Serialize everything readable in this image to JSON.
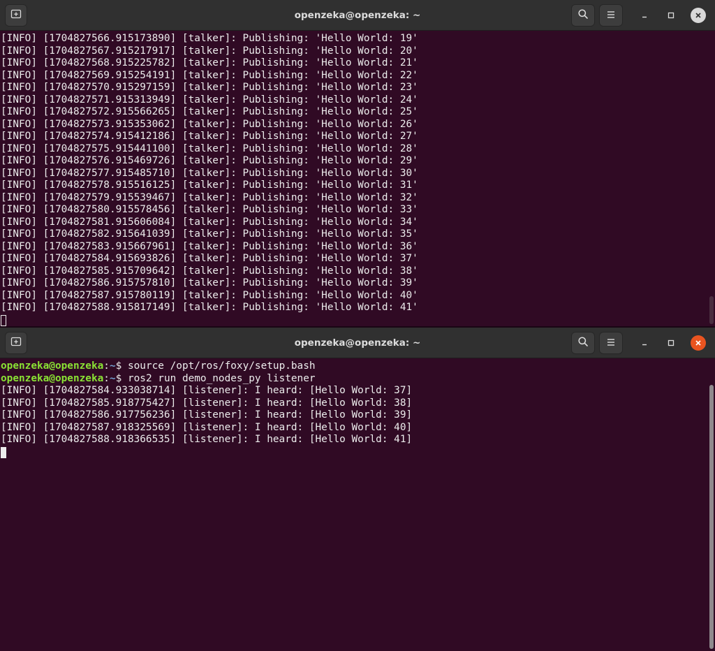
{
  "top_window": {
    "title": "openzeka@openzeka: ~",
    "lines": [
      "[INFO] [1704827566.915173890] [talker]: Publishing: 'Hello World: 19'",
      "[INFO] [1704827567.915217917] [talker]: Publishing: 'Hello World: 20'",
      "[INFO] [1704827568.915225782] [talker]: Publishing: 'Hello World: 21'",
      "[INFO] [1704827569.915254191] [talker]: Publishing: 'Hello World: 22'",
      "[INFO] [1704827570.915297159] [talker]: Publishing: 'Hello World: 23'",
      "[INFO] [1704827571.915313949] [talker]: Publishing: 'Hello World: 24'",
      "[INFO] [1704827572.915566265] [talker]: Publishing: 'Hello World: 25'",
      "[INFO] [1704827573.915353062] [talker]: Publishing: 'Hello World: 26'",
      "[INFO] [1704827574.915412186] [talker]: Publishing: 'Hello World: 27'",
      "[INFO] [1704827575.915441100] [talker]: Publishing: 'Hello World: 28'",
      "[INFO] [1704827576.915469726] [talker]: Publishing: 'Hello World: 29'",
      "[INFO] [1704827577.915485710] [talker]: Publishing: 'Hello World: 30'",
      "[INFO] [1704827578.915516125] [talker]: Publishing: 'Hello World: 31'",
      "[INFO] [1704827579.915539467] [talker]: Publishing: 'Hello World: 32'",
      "[INFO] [1704827580.915578456] [talker]: Publishing: 'Hello World: 33'",
      "[INFO] [1704827581.915606084] [talker]: Publishing: 'Hello World: 34'",
      "[INFO] [1704827582.915641039] [talker]: Publishing: 'Hello World: 35'",
      "[INFO] [1704827583.915667961] [talker]: Publishing: 'Hello World: 36'",
      "[INFO] [1704827584.915693826] [talker]: Publishing: 'Hello World: 37'",
      "[INFO] [1704827585.915709642] [talker]: Publishing: 'Hello World: 38'",
      "[INFO] [1704827586.915757810] [talker]: Publishing: 'Hello World: 39'",
      "[INFO] [1704827587.915780119] [talker]: Publishing: 'Hello World: 40'",
      "[INFO] [1704827588.915817149] [talker]: Publishing: 'Hello World: 41'"
    ]
  },
  "bottom_window": {
    "title": "openzeka@openzeka: ~",
    "prompt_user": "openzeka@openzeka",
    "prompt_sep": ":",
    "prompt_path": "~",
    "prompt_symbol": "$ ",
    "commands": [
      "source /opt/ros/foxy/setup.bash",
      "ros2 run demo_nodes_py listener"
    ],
    "lines": [
      "[INFO] [1704827584.933038714] [listener]: I heard: [Hello World: 37]",
      "[INFO] [1704827585.918775427] [listener]: I heard: [Hello World: 38]",
      "[INFO] [1704827586.917756236] [listener]: I heard: [Hello World: 39]",
      "[INFO] [1704827587.918325569] [listener]: I heard: [Hello World: 40]",
      "[INFO] [1704827588.918366535] [listener]: I heard: [Hello World: 41]"
    ]
  },
  "icons": {
    "new_tab": "new-tab-icon",
    "search": "search-icon",
    "menu": "hamburger-menu-icon",
    "minimize": "minimize-icon",
    "maximize": "maximize-icon",
    "close": "close-icon"
  },
  "colors": {
    "terminal_bg": "#300a24",
    "prompt_user": "#8ae234",
    "prompt_path": "#729fcf",
    "close_active": "#e95420"
  }
}
